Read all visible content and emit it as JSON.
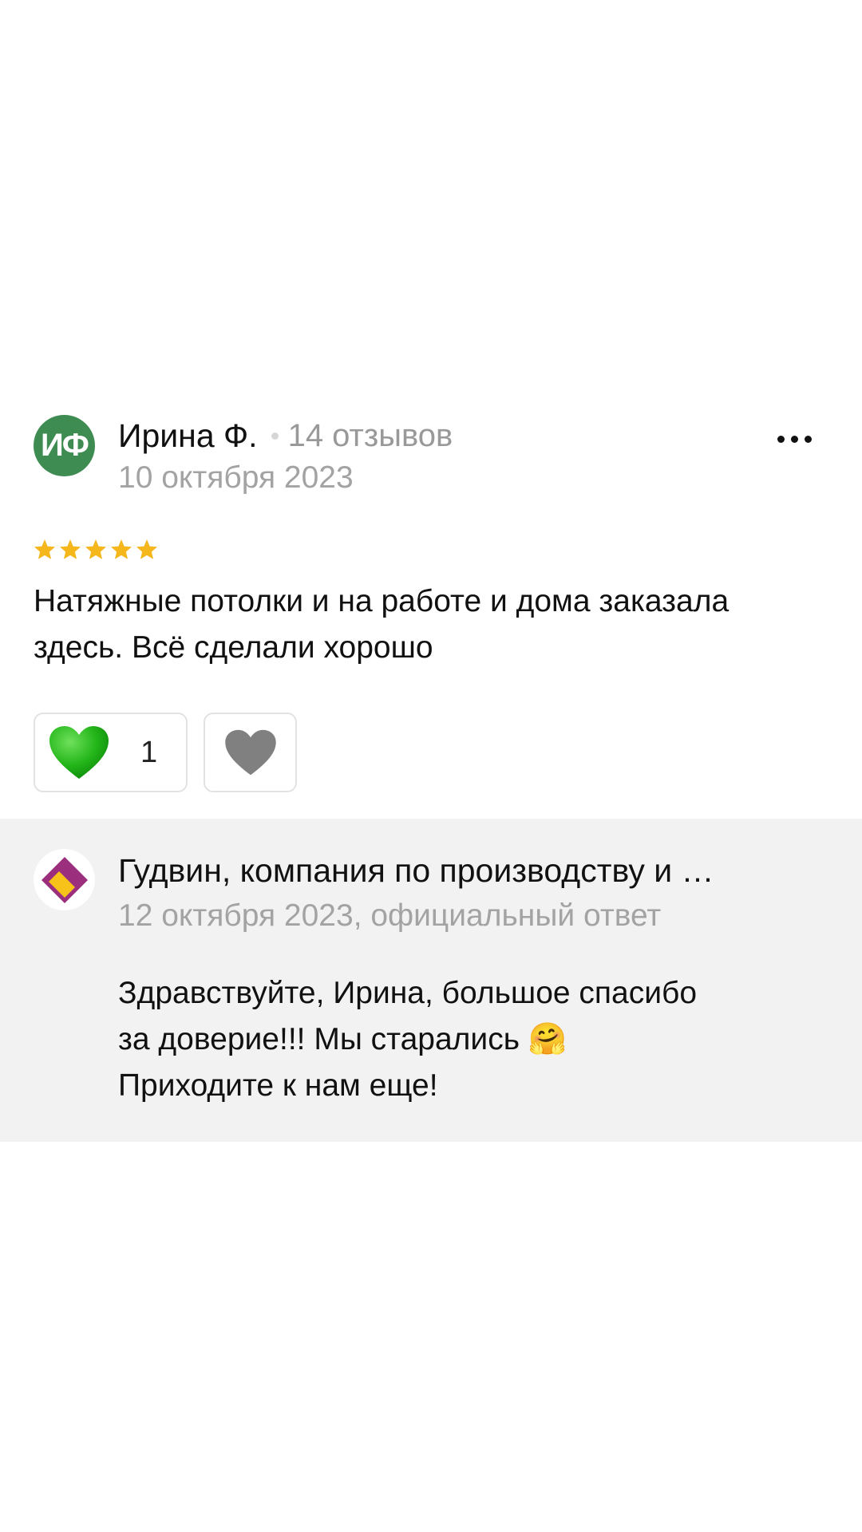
{
  "review": {
    "avatar_initials": "ИФ",
    "author": "Ирина Ф.",
    "reviews_count": "14 отзывов",
    "date": "10 октября 2023",
    "rating": 5,
    "text": "Натяжные потолки и на работе и дома заказала здесь. Всё сделали хорошо",
    "likes": "1",
    "colors": {
      "avatar_bg": "#3f8c53",
      "star": "#f5b71c",
      "like_heart": "#22b518",
      "dislike_heart": "#808080"
    }
  },
  "answer": {
    "company": "Гудвин, компания по производству и …",
    "meta": "12 октября 2023, официальный ответ",
    "text_line1": "Здравствуйте, Ирина, большое спасибо",
    "text_line2": "за доверие!!! Мы старались",
    "text_emoji": "🤗",
    "text_line3": "Приходите к нам еще!",
    "colors": {
      "background": "#f2f2f2",
      "logo_purple": "#9c2e7e",
      "logo_yellow": "#f7c21a"
    }
  }
}
